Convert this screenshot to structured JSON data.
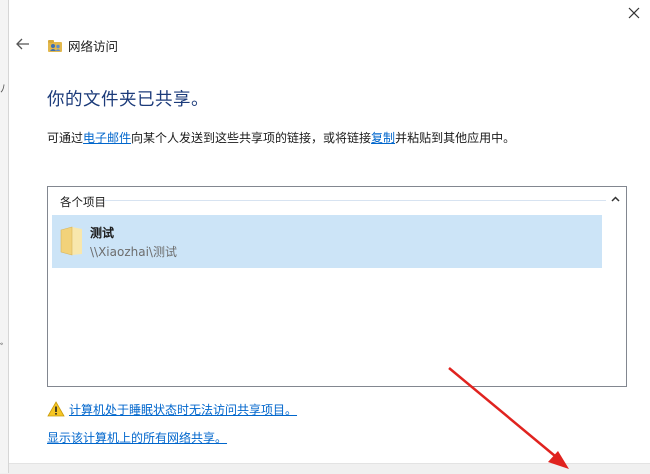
{
  "window": {
    "title": "网络访问",
    "close_glyph": "✕",
    "back_glyph": "←"
  },
  "main": {
    "heading": "你的文件夹已共享。",
    "description": {
      "part1": "可通过",
      "email_link": "电子邮件",
      "part2": "向某个人发送到这些共享项的链接，或将链接",
      "copy_link": "复制",
      "part3": "并粘贴到其他应用中。"
    }
  },
  "list": {
    "group_label": "各个项目",
    "items": [
      {
        "name": "测试",
        "path": "\\\\Xiaozhai\\测试"
      }
    ]
  },
  "footer_links": {
    "sleep_warning": "计算机处于睡眠状态时无法访问共享项目。",
    "show_all_shares": "显示该计算机上的所有网络共享。"
  },
  "colors": {
    "heading": "#1c3b7a",
    "link": "#0066cc",
    "selection": "#cce4f7",
    "annotation_arrow": "#e0231f"
  }
}
